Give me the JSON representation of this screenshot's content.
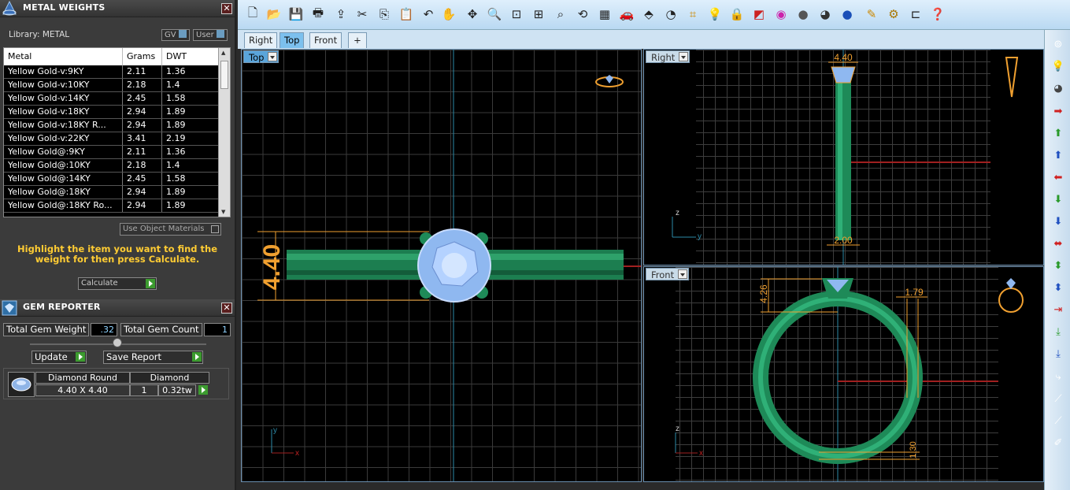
{
  "metal_panel": {
    "title": "METAL WEIGHTS",
    "library_label": "Library: METAL",
    "toggle_gv": "GV",
    "toggle_user": "User",
    "columns": [
      "Metal",
      "Grams",
      "DWT"
    ],
    "rows": [
      [
        "Yellow Gold-v:9KY",
        "2.11",
        "1.36"
      ],
      [
        "Yellow Gold-v:10KY",
        "2.18",
        "1.4"
      ],
      [
        "Yellow Gold-v:14KY",
        "2.45",
        "1.58"
      ],
      [
        "Yellow Gold-v:18KY",
        "2.94",
        "1.89"
      ],
      [
        "Yellow Gold-v:18KY R...",
        "2.94",
        "1.89"
      ],
      [
        "Yellow Gold-v:22KY",
        "3.41",
        "2.19"
      ],
      [
        "Yellow Gold@:9KY",
        "2.11",
        "1.36"
      ],
      [
        "Yellow Gold@:10KY",
        "2.18",
        "1.4"
      ],
      [
        "Yellow Gold@:14KY",
        "2.45",
        "1.58"
      ],
      [
        "Yellow Gold@:18KY",
        "2.94",
        "1.89"
      ],
      [
        "Yellow Gold@:18KY Ro...",
        "2.94",
        "1.89"
      ]
    ],
    "use_object_materials": "Use Object Materials",
    "hint": "Highlight the item you want to find the weight for then press Calculate.",
    "calculate_label": "Calculate"
  },
  "gem_panel": {
    "title": "GEM REPORTER",
    "total_weight_label": "Total Gem Weight",
    "total_weight_value": ".32",
    "total_count_label": "Total Gem Count",
    "total_count_value": "1",
    "update_label": "Update",
    "save_report_label": "Save Report",
    "gem_name": "Diamond Round",
    "gem_material": "Diamond",
    "gem_size": "4.40 X 4.40",
    "gem_count": "1",
    "gem_weight": "0.32tw"
  },
  "view_tabs": [
    "Right",
    "Top",
    "Front",
    "+"
  ],
  "active_tab": "Top",
  "viewports": {
    "top": {
      "label": "Top",
      "dimension": "4.40"
    },
    "right": {
      "label": "Right",
      "dim_top": "4.40",
      "dim_bottom": "2.00"
    },
    "front": {
      "label": "Front",
      "dim_left": "4.26",
      "dim_right": "1.79",
      "dim_bottom": "1.30"
    }
  },
  "axis_labels": {
    "x": "x",
    "y": "y",
    "z": "z"
  },
  "colors": {
    "ring_green": "#1e8a58",
    "dimension_orange": "#f0a030",
    "gem_blue": "#8fb8f0"
  }
}
